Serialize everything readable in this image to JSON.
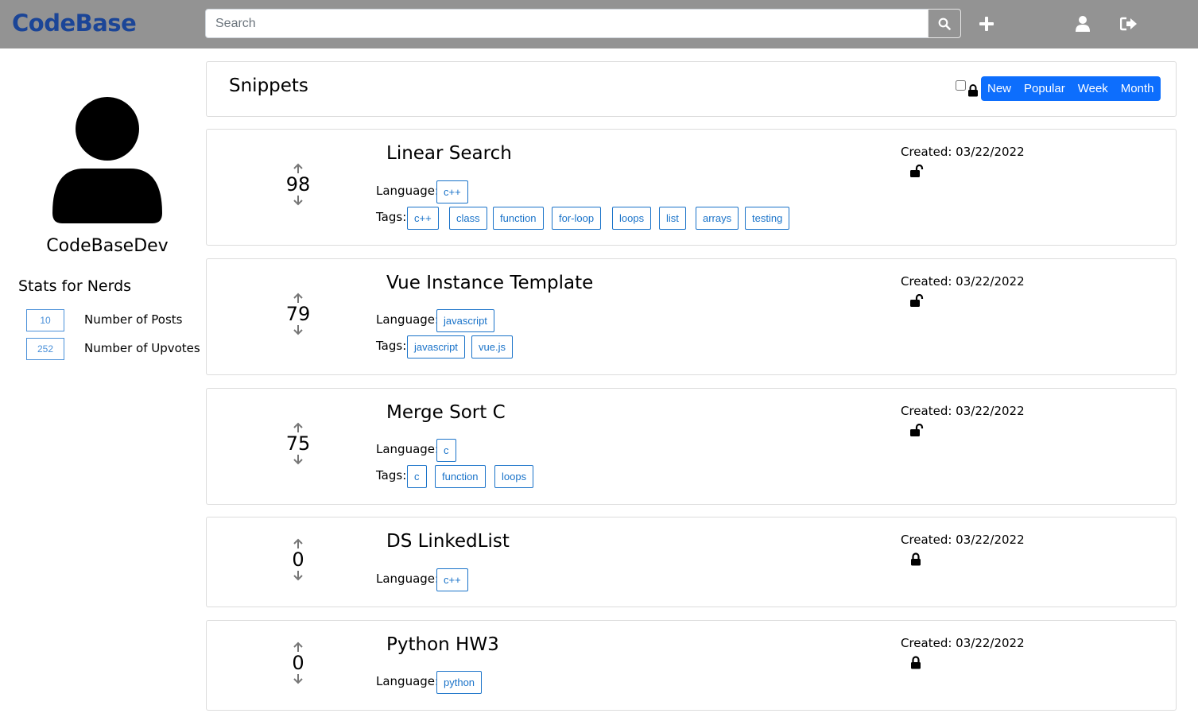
{
  "header": {
    "brand": "CodeBase",
    "search_placeholder": "Search",
    "search_value": "",
    "icons": [
      "search-icon",
      "plus-icon",
      "user-icon",
      "sign-out-icon"
    ]
  },
  "sidebar": {
    "username": "CodeBaseDev",
    "stats_title": "Stats for Nerds",
    "stats": [
      {
        "value": "10",
        "label": "Number of Posts"
      },
      {
        "value": "252",
        "label": "Number of Upvotes"
      }
    ]
  },
  "snippets_header": {
    "title": "Snippets",
    "filters": [
      "New",
      "Popular",
      "Week",
      "Month"
    ],
    "accent_color": "#0d6efd"
  },
  "posts": [
    {
      "title": "Linear Search",
      "votes": "98",
      "language_label": "Language:",
      "language": "c++",
      "tags_label": "Tags:",
      "tags": [
        "c++",
        "class",
        "function",
        "for-loop",
        "loops",
        "list",
        "arrays",
        "testing"
      ],
      "created": "Created: 03/22/2022",
      "lock": "unlocked"
    },
    {
      "title": "Vue Instance Template",
      "votes": "79",
      "language_label": "Language:",
      "language": "javascript",
      "tags_label": "Tags:",
      "tags": [
        "javascript",
        "vue.js"
      ],
      "created": "Created: 03/22/2022",
      "lock": "unlocked"
    },
    {
      "title": "Merge Sort C",
      "votes": "75",
      "language_label": "Language:",
      "language": "c",
      "tags_label": "Tags:",
      "tags": [
        "c",
        "function",
        "loops"
      ],
      "created": "Created: 03/22/2022",
      "lock": "unlocked"
    },
    {
      "title": "DS LinkedList",
      "votes": "0",
      "language_label": "Language:",
      "language": "c++",
      "created": "Created: 03/22/2022",
      "lock": "locked"
    },
    {
      "title": "Python HW3",
      "votes": "0",
      "language_label": "Language:",
      "language": "python",
      "created": "Created: 03/22/2022",
      "lock": "locked"
    }
  ]
}
